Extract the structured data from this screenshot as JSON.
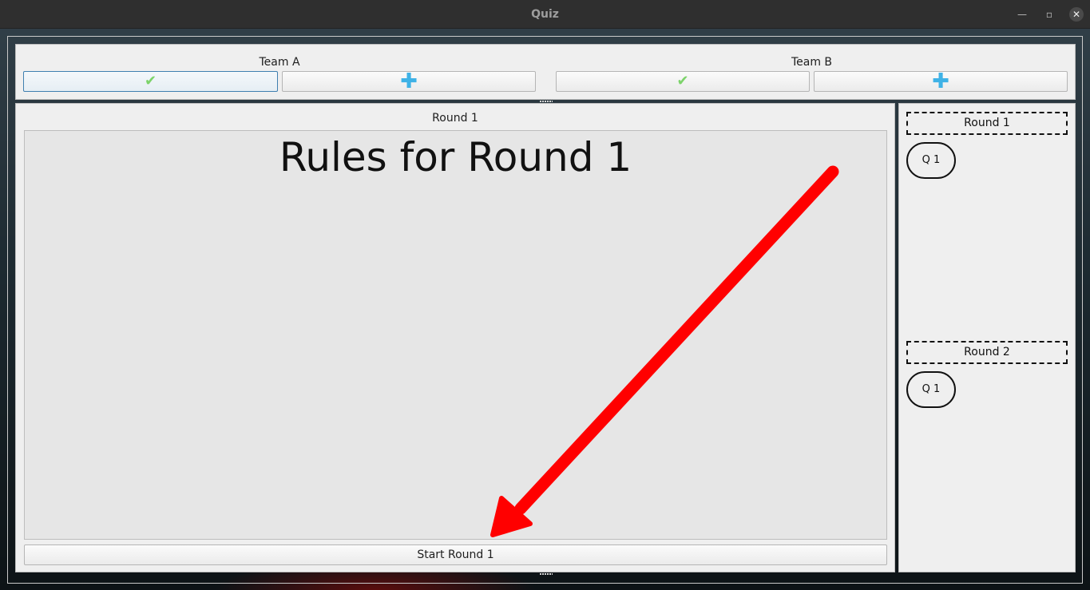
{
  "window": {
    "title": "Quiz"
  },
  "teams": [
    {
      "name": "Team A",
      "correct_icon": "check-icon",
      "add_icon": "plus-icon"
    },
    {
      "name": "Team B",
      "correct_icon": "check-icon",
      "add_icon": "plus-icon"
    }
  ],
  "main": {
    "round_title": "Round 1",
    "rules_heading": "Rules for Round 1",
    "start_button_label": "Start Round 1"
  },
  "sidebar": {
    "rounds": [
      {
        "label": "Round 1",
        "questions": [
          "Q 1"
        ]
      },
      {
        "label": "Round 2",
        "questions": [
          "Q 1"
        ]
      }
    ]
  },
  "colors": {
    "check": "#7cd36a",
    "plus": "#3fb2e6",
    "annotation_arrow": "#ff0000"
  }
}
